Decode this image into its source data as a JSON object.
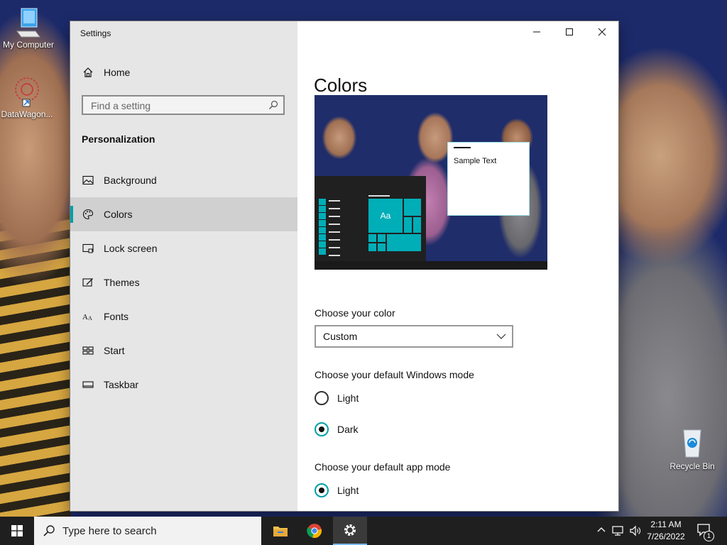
{
  "desktop": {
    "icons": [
      {
        "label": "My Computer",
        "icon": "computer-icon"
      },
      {
        "label": "DataWagon...",
        "icon": "shortcut-icon"
      },
      {
        "label": "Recycle Bin",
        "icon": "recycle-bin-icon"
      }
    ]
  },
  "window": {
    "title": "Settings",
    "controls": {
      "minimize": "minimize-icon",
      "maximize": "maximize-icon",
      "close": "close-icon"
    }
  },
  "sidebar": {
    "home_label": "Home",
    "search_placeholder": "Find a setting",
    "section_title": "Personalization",
    "items": [
      {
        "label": "Background",
        "icon": "picture-icon",
        "active": false
      },
      {
        "label": "Colors",
        "icon": "palette-icon",
        "active": true
      },
      {
        "label": "Lock screen",
        "icon": "lock-screen-icon",
        "active": false
      },
      {
        "label": "Themes",
        "icon": "themes-icon",
        "active": false
      },
      {
        "label": "Fonts",
        "icon": "fonts-icon",
        "active": false
      },
      {
        "label": "Start",
        "icon": "start-icon",
        "active": false
      },
      {
        "label": "Taskbar",
        "icon": "taskbar-icon",
        "active": false
      }
    ]
  },
  "content": {
    "title": "Colors",
    "preview": {
      "sample_text": "Sample Text",
      "tile_label": "Aa"
    },
    "choose_color_label": "Choose your color",
    "choose_color_value": "Custom",
    "windows_mode_label": "Choose your default Windows mode",
    "windows_mode_options": [
      {
        "label": "Light",
        "checked": false
      },
      {
        "label": "Dark",
        "checked": true
      }
    ],
    "app_mode_label": "Choose your default app mode",
    "app_mode_options": [
      {
        "label": "Light",
        "checked": true
      }
    ]
  },
  "taskbar": {
    "search_text": "Type here to search",
    "apps": [
      "file-explorer-icon",
      "chrome-icon",
      "settings-icon"
    ],
    "clock_time": "2:11 AM",
    "clock_date": "7/26/2022",
    "notification_count": "1"
  },
  "colors": {
    "accent": "#00a0a8",
    "tile": "#00aeb8",
    "taskbar": "#1f1f1f"
  }
}
